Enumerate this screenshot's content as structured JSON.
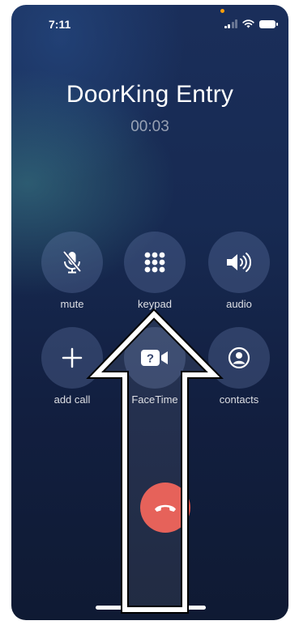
{
  "status_bar": {
    "time": "7:11",
    "icons": [
      "signal-icon",
      "wifi-icon",
      "battery-icon"
    ]
  },
  "call": {
    "caller_name": "DoorKing Entry",
    "duration": "00:03"
  },
  "controls": [
    {
      "id": "mute",
      "label": "mute",
      "icon": "microphone-slash-icon"
    },
    {
      "id": "keypad",
      "label": "keypad",
      "icon": "keypad-icon"
    },
    {
      "id": "audio",
      "label": "audio",
      "icon": "speaker-icon"
    },
    {
      "id": "add-call",
      "label": "add call",
      "icon": "plus-icon"
    },
    {
      "id": "facetime",
      "label": "FaceTime",
      "icon": "facetime-icon"
    },
    {
      "id": "contacts",
      "label": "contacts",
      "icon": "person-circle-icon"
    }
  ],
  "end_call": {
    "icon": "phone-down-icon"
  },
  "colors": {
    "end_call": "#e4554c",
    "status_dot": "#ff9f0a",
    "background_top": "#1a2e5a",
    "background_bottom": "#0f1a33"
  },
  "overlay": {
    "icon": "up-arrow-icon"
  }
}
